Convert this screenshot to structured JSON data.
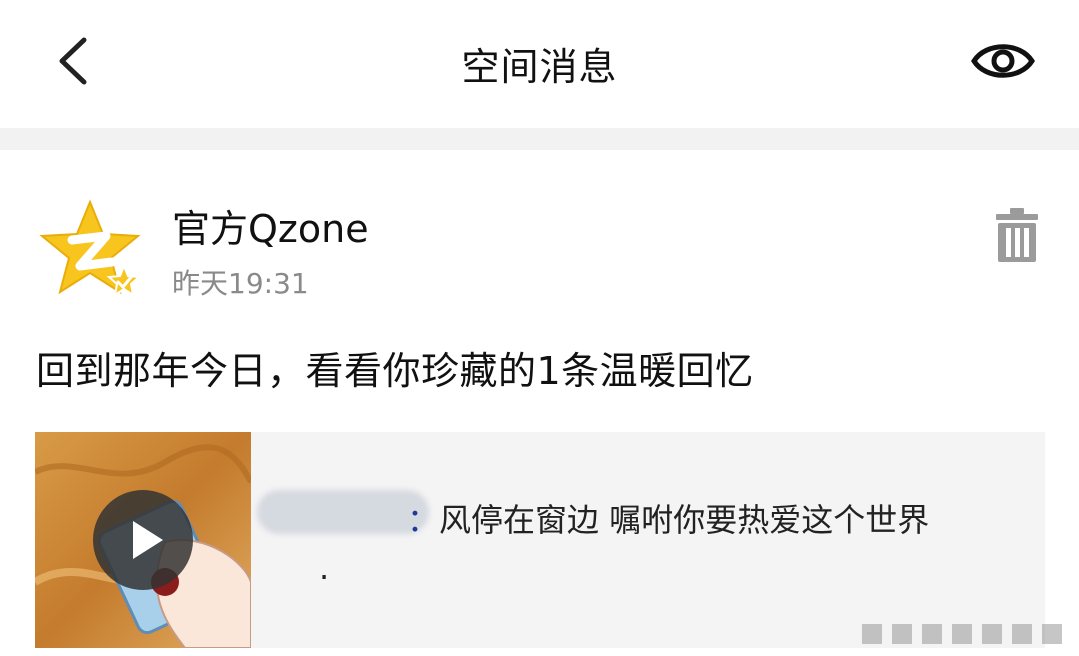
{
  "header": {
    "title": "空间消息",
    "back_icon": "chevron-left-icon",
    "eye_icon": "eye-icon"
  },
  "post": {
    "username": "官方Qzone",
    "time": "昨天19:31",
    "message": "回到那年今日，看看你珍藏的1条温暖回忆",
    "avatar_icon": "qzone-star-icon",
    "delete_icon": "trash-icon"
  },
  "card": {
    "name_separator": "：",
    "text": "风停在窗边 嘱咐你要热爱这个世界",
    "text_tail": ".",
    "play_icon": "play-icon"
  },
  "colors": {
    "accent_star": "#f7c51e",
    "link_name": "#1f3a93",
    "divider": "#f2f2f2",
    "card_bg": "#f4f4f4"
  }
}
